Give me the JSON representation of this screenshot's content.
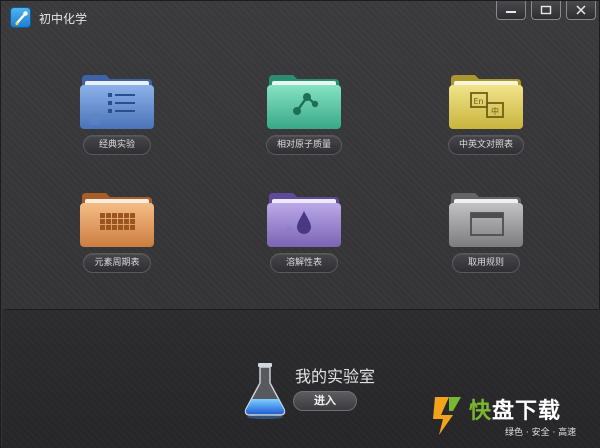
{
  "app": {
    "title": "初中化学"
  },
  "window_controls": {
    "minimize": "minimize-icon",
    "maximize": "maximize-icon",
    "close": "close-icon"
  },
  "tiles": [
    {
      "label": "经典实验",
      "icon": "list-icon",
      "color": "#6d95d6"
    },
    {
      "label": "相对原子质量",
      "icon": "molecule-icon",
      "color": "#5fc8a7"
    },
    {
      "label": "中英文对照表",
      "icon": "translate-icon",
      "color": "#e0cf63"
    },
    {
      "label": "元素周期表",
      "icon": "periodic-table-icon",
      "color": "#e7a064"
    },
    {
      "label": "溶解性表",
      "icon": "drop-icon",
      "color": "#9a86cf"
    },
    {
      "label": "取用规则",
      "icon": "window-icon",
      "color": "#9b9b9d"
    }
  ],
  "lab": {
    "title": "我的实验室",
    "enter_label": "进入",
    "icon": "flask-icon"
  },
  "watermark": {
    "name_a": "快",
    "name_b": "盘下载",
    "tagline": "绿色 · 安全 · 高速"
  },
  "colors": {
    "background": "#353538",
    "lower_background": "#29292b",
    "pill_text": "#dcdcdc",
    "watermark_green": "#7cb82f"
  }
}
